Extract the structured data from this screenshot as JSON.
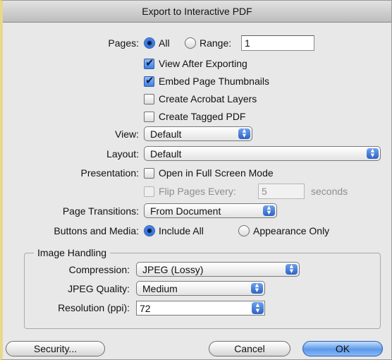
{
  "dialog": {
    "title": "Export to Interactive PDF"
  },
  "pages": {
    "label": "Pages:",
    "all_label": "All",
    "range_label": "Range:",
    "range_value": "1",
    "selected": "All"
  },
  "options": {
    "view_after_exporting": {
      "label": "View After Exporting",
      "checked": true
    },
    "embed_page_thumbnails": {
      "label": "Embed Page Thumbnails",
      "checked": true
    },
    "create_acrobat_layers": {
      "label": "Create Acrobat Layers",
      "checked": false
    },
    "create_tagged_pdf": {
      "label": "Create Tagged PDF",
      "checked": false
    }
  },
  "view": {
    "label": "View:",
    "value": "Default"
  },
  "layout": {
    "label": "Layout:",
    "value": "Default"
  },
  "presentation": {
    "label": "Presentation:",
    "full_screen_label": "Open in Full Screen Mode",
    "full_screen_checked": false,
    "flip_label": "Flip Pages Every:",
    "flip_value": "5",
    "flip_unit": "seconds",
    "flip_enabled": false
  },
  "page_transitions": {
    "label": "Page Transitions:",
    "value": "From Document"
  },
  "buttons_media": {
    "label": "Buttons and Media:",
    "include_all_label": "Include All",
    "appearance_only_label": "Appearance Only",
    "selected": "Include All"
  },
  "image_handling": {
    "title": "Image Handling",
    "compression_label": "Compression:",
    "compression_value": "JPEG (Lossy)",
    "jpeg_quality_label": "JPEG Quality:",
    "jpeg_quality_value": "Medium",
    "resolution_label": "Resolution (ppi):",
    "resolution_value": "72"
  },
  "buttons": {
    "security": "Security...",
    "cancel": "Cancel",
    "ok": "OK"
  },
  "colors": {
    "accent": "#3d7be0",
    "window_bg": "#e8e8e8"
  }
}
